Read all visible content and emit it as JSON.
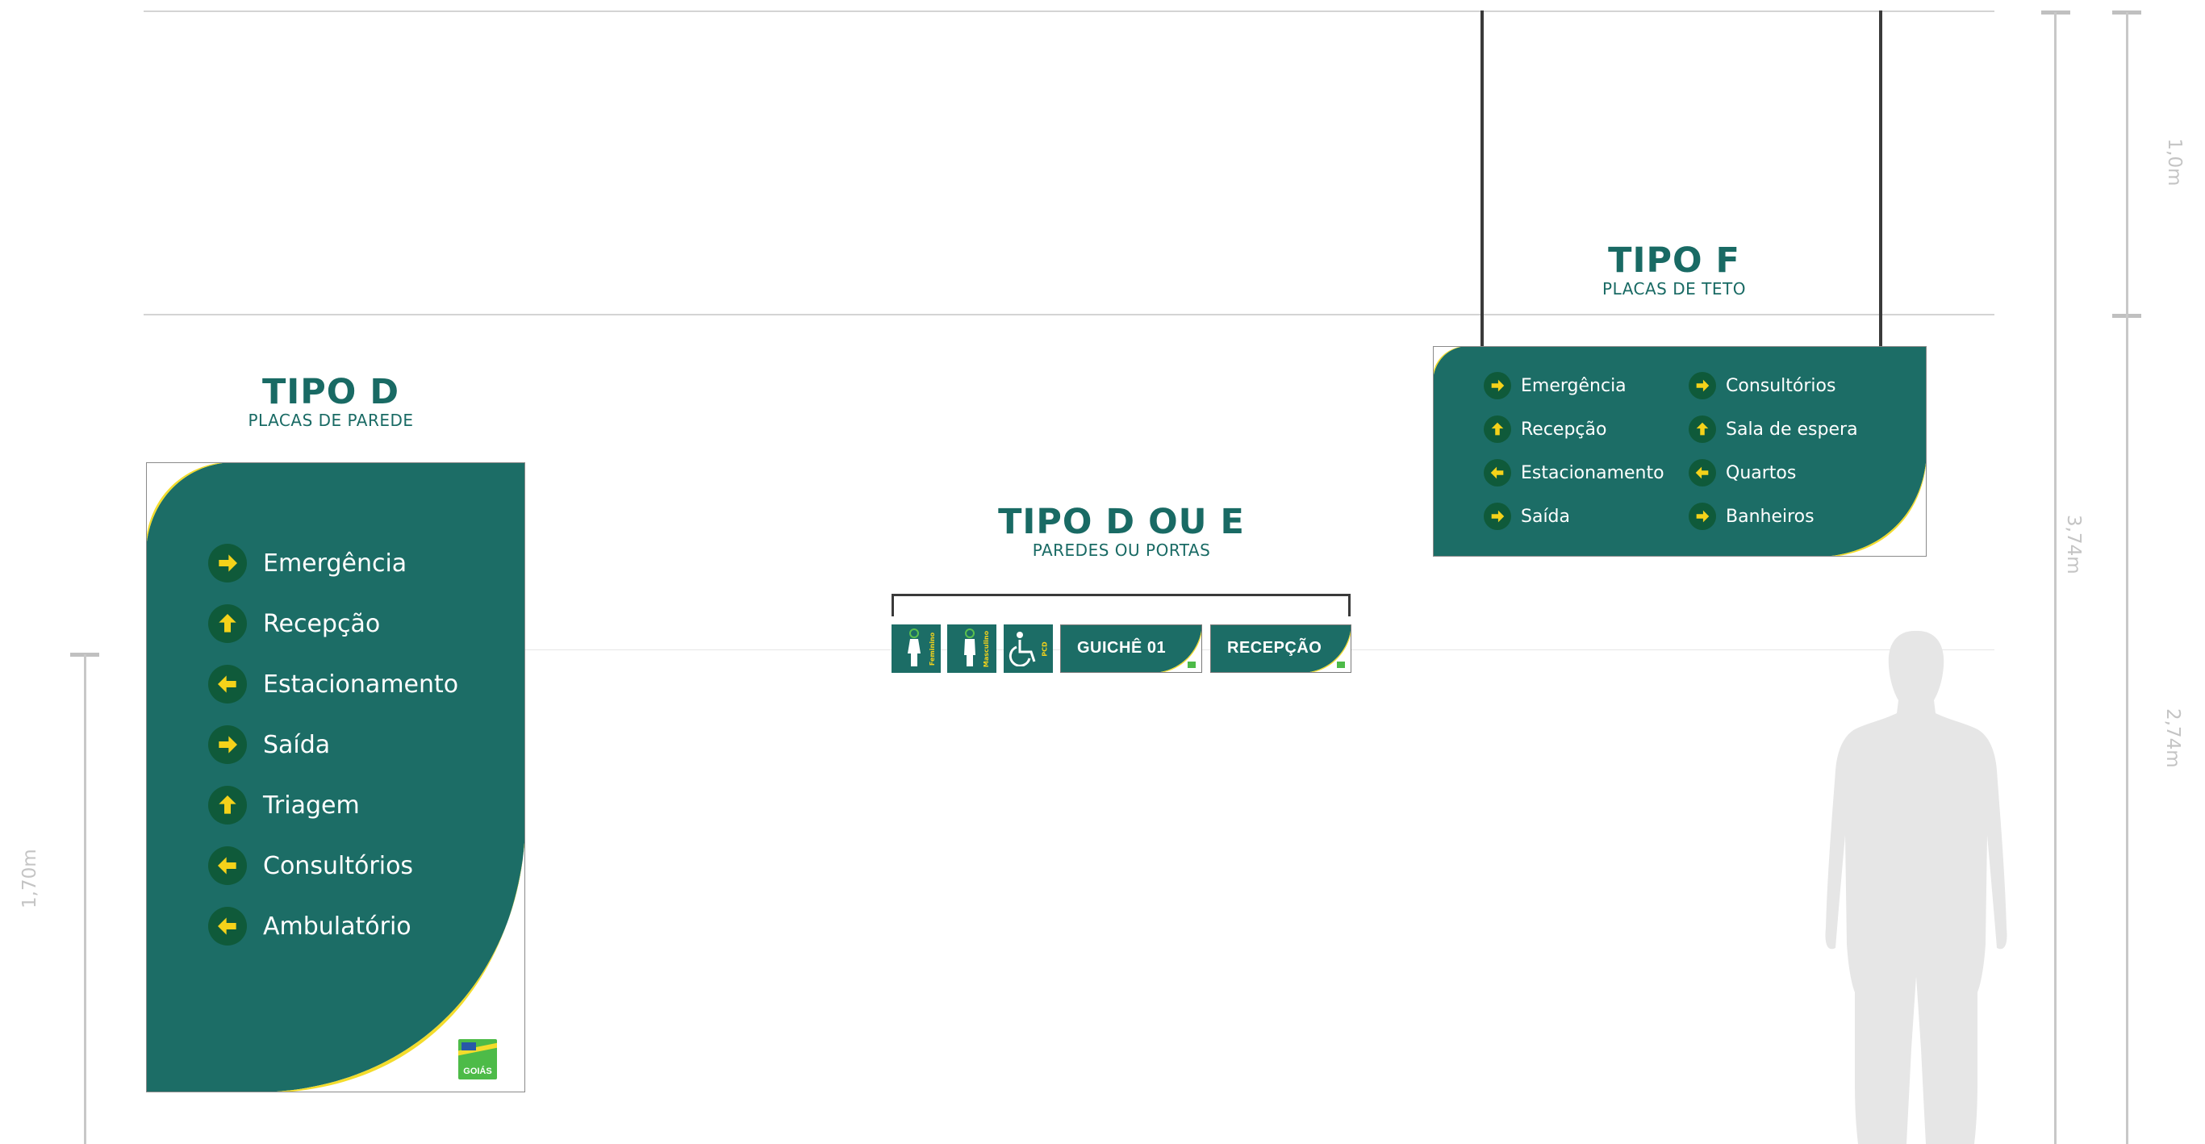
{
  "colors": {
    "sign_green": "#1c6d66",
    "arrow_circle": "#0f5a3a",
    "arrow_yellow": "#f5d21a",
    "accent_yellow": "#f3dc2c",
    "heading_green": "#196a64",
    "dimension_gray": "#c4c4c4",
    "silhouette_gray": "#e6e6e6"
  },
  "tipo_d": {
    "title": "TIPO D",
    "subtitle": "PLACAS DE PAREDE",
    "items": [
      {
        "label": "Emergência",
        "arrow": "right"
      },
      {
        "label": "Recepção",
        "arrow": "up"
      },
      {
        "label": "Estacionamento",
        "arrow": "left"
      },
      {
        "label": "Saída",
        "arrow": "right"
      },
      {
        "label": "Triagem",
        "arrow": "up"
      },
      {
        "label": "Consultórios",
        "arrow": "left"
      },
      {
        "label": "Ambulatório",
        "arrow": "left"
      }
    ],
    "logo_text": "GOIÁS"
  },
  "tipo_d_ou_e": {
    "title": "TIPO D OU E",
    "subtitle": "PAREDES OU PORTAS",
    "plates": [
      {
        "icon": "female-icon",
        "vertical_text": "Feminino"
      },
      {
        "icon": "male-icon",
        "vertical_text": "Masculino"
      },
      {
        "icon": "wheelchair-icon",
        "vertical_text": "PCD"
      }
    ],
    "labels": [
      "GUICHÊ 01",
      "RECEPÇÃO"
    ]
  },
  "tipo_f": {
    "title": "TIPO F",
    "subtitle": "PLACAS DE TETO",
    "items_left": [
      {
        "label": "Emergência",
        "arrow": "right"
      },
      {
        "label": "Recepção",
        "arrow": "up"
      },
      {
        "label": "Estacionamento",
        "arrow": "left"
      },
      {
        "label": "Saída",
        "arrow": "right"
      }
    ],
    "items_right": [
      {
        "label": "Consultórios",
        "arrow": "right"
      },
      {
        "label": "Sala de espera",
        "arrow": "up"
      },
      {
        "label": "Quartos",
        "arrow": "left"
      },
      {
        "label": "Banheiros",
        "arrow": "right"
      }
    ]
  },
  "dimensions": {
    "d1": "1,70m",
    "d2": "1,0m",
    "d3": "3,74m",
    "d4": "2,74m"
  }
}
